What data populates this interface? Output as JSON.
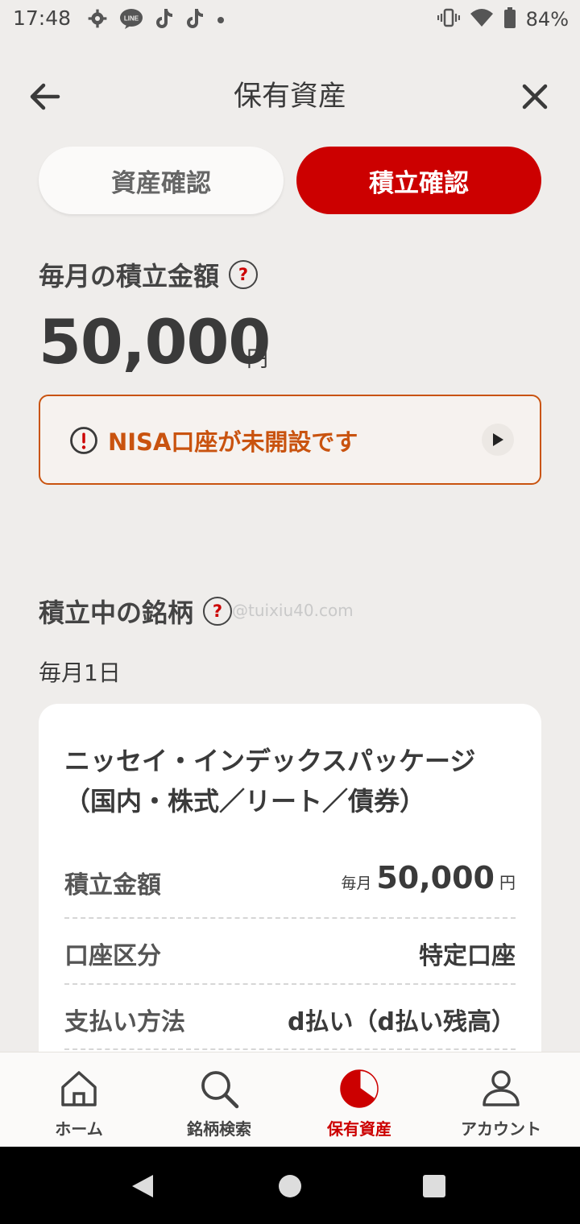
{
  "status_bar": {
    "time": "17:48",
    "battery_percent": "84%",
    "left_icons": [
      "gear-icon",
      "line-icon",
      "tiktok-icon",
      "tiktok-icon",
      "dot-icon"
    ],
    "right_icons": [
      "vibrate-icon",
      "wifi-icon",
      "battery-icon"
    ]
  },
  "header": {
    "title": "保有資産"
  },
  "tabs": [
    {
      "label": "資産確認",
      "active": false
    },
    {
      "label": "積立確認",
      "active": true
    }
  ],
  "monthly": {
    "label": "毎月の積立金額",
    "amount": "50,000",
    "unit": "円"
  },
  "notice": {
    "text": "NISA口座が未開設です"
  },
  "holdings": {
    "label": "積立中の銘柄",
    "date_label": "毎月1日",
    "fund": {
      "name": "ニッセイ・インデックスパッケージ（国内・株式／リート／債券）",
      "rows": [
        {
          "label": "積立金額",
          "prefix": "毎月",
          "value": "50,000",
          "unit": "円"
        },
        {
          "label": "口座区分",
          "value": "特定口座"
        },
        {
          "label": "支払い方法",
          "value": "d払い（d払い残高）"
        }
      ]
    }
  },
  "watermark": "@tuixiu40.com",
  "bottom_nav": [
    {
      "label": "ホーム",
      "icon": "home-icon",
      "active": false
    },
    {
      "label": "銘柄検索",
      "icon": "search-icon",
      "active": false
    },
    {
      "label": "保有資産",
      "icon": "pie-chart-icon",
      "active": true
    },
    {
      "label": "アカウント",
      "icon": "person-icon",
      "active": false
    }
  ],
  "colors": {
    "accent": "#cc0000",
    "warning": "#c9530f",
    "background": "#efedeb"
  }
}
